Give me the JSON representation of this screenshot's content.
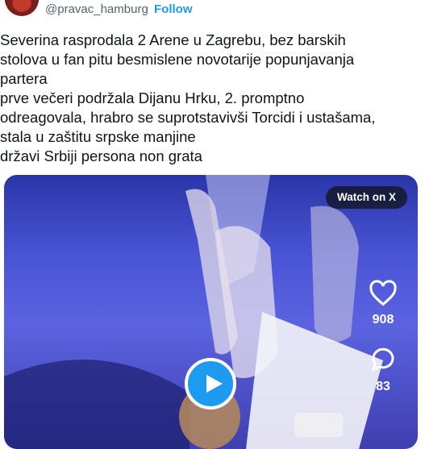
{
  "header": {
    "handle": "@pravac_hamburg",
    "separator": "·",
    "follow_label": "Follow"
  },
  "tweet": {
    "lines": [
      "Severina rasprodala 2 Arene u Zagrebu, bez barskih",
      "stolova u fan pitu besmislene novotarije popunjavanja",
      "partera",
      "prve večeri podržala Dijanu Hrku, 2. promptno",
      "odreagovala, hrabro se suprotstavivši Torcidi i ustašama,",
      "stala u zaštitu srpske manjine",
      "državi Srbiji persona non grata"
    ]
  },
  "media": {
    "watch_label": "Watch on X",
    "likes_count": "908",
    "replies_count": "83",
    "icons": [
      "heart-icon",
      "comment-icon",
      "play-icon"
    ],
    "colors": {
      "play_button": "#1d9bf0",
      "accent": "#1d9bf0"
    }
  }
}
